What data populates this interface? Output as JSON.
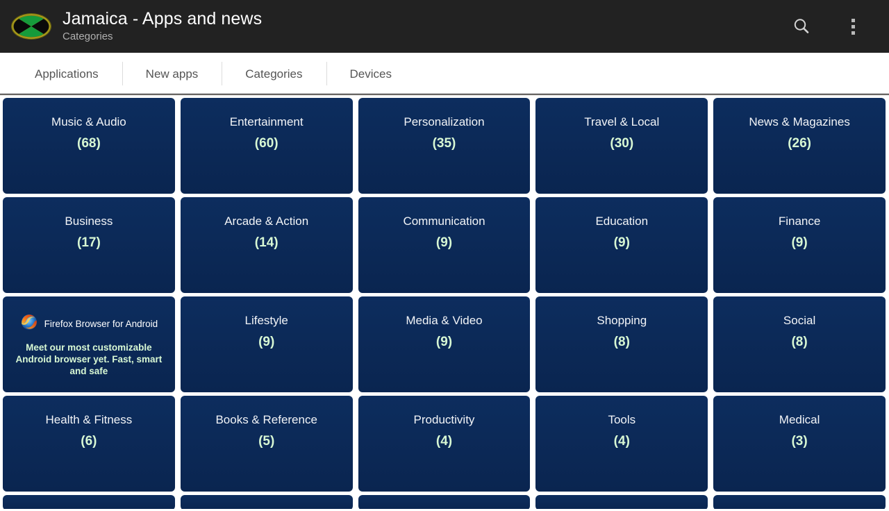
{
  "header": {
    "logo_icon": "jamaica-flag-oval-icon",
    "title": "Jamaica - Apps and news",
    "subtitle": "Categories",
    "search_icon": "search-icon",
    "overflow_icon": "overflow-menu-icon"
  },
  "tabs": [
    {
      "label": "Applications",
      "selected": false
    },
    {
      "label": "New apps",
      "selected": false
    },
    {
      "label": "Categories",
      "selected": true
    },
    {
      "label": "Devices",
      "selected": false
    }
  ],
  "ad": {
    "icon": "firefox-icon",
    "title": "Firefox Browser for Android",
    "body": "Meet our most customizable Android browser yet. Fast, smart and safe"
  },
  "colors": {
    "header_bg": "#222222",
    "card_bg": "#0b2a59",
    "card_title": "#f2f4f7",
    "card_count": "#d8f8d4",
    "tab_text": "#555555",
    "page_bg": "#ffffff"
  },
  "grid": {
    "rows": [
      [
        {
          "title": "Music & Audio",
          "count": "(68)"
        },
        {
          "title": "Entertainment",
          "count": "(60)"
        },
        {
          "title": "Personalization",
          "count": "(35)"
        },
        {
          "title": "Travel & Local",
          "count": "(30)"
        },
        {
          "title": "News & Magazines",
          "count": "(26)"
        }
      ],
      [
        {
          "title": "Business",
          "count": "(17)"
        },
        {
          "title": "Arcade & Action",
          "count": "(14)"
        },
        {
          "title": "Communication",
          "count": "(9)"
        },
        {
          "title": "Education",
          "count": "(9)"
        },
        {
          "title": "Finance",
          "count": "(9)"
        }
      ],
      [
        {
          "ad": true
        },
        {
          "title": "Lifestyle",
          "count": "(9)"
        },
        {
          "title": "Media & Video",
          "count": "(9)"
        },
        {
          "title": "Shopping",
          "count": "(8)"
        },
        {
          "title": "Social",
          "count": "(8)"
        }
      ],
      [
        {
          "title": "Health & Fitness",
          "count": "(6)"
        },
        {
          "title": "Books & Reference",
          "count": "(5)"
        },
        {
          "title": "Productivity",
          "count": "(4)"
        },
        {
          "title": "Tools",
          "count": "(4)"
        },
        {
          "title": "Medical",
          "count": "(3)"
        }
      ],
      [
        {
          "title": "",
          "count": ""
        },
        {
          "title": "",
          "count": ""
        },
        {
          "title": "",
          "count": ""
        },
        {
          "title": "",
          "count": ""
        },
        {
          "title": "",
          "count": ""
        }
      ]
    ]
  }
}
